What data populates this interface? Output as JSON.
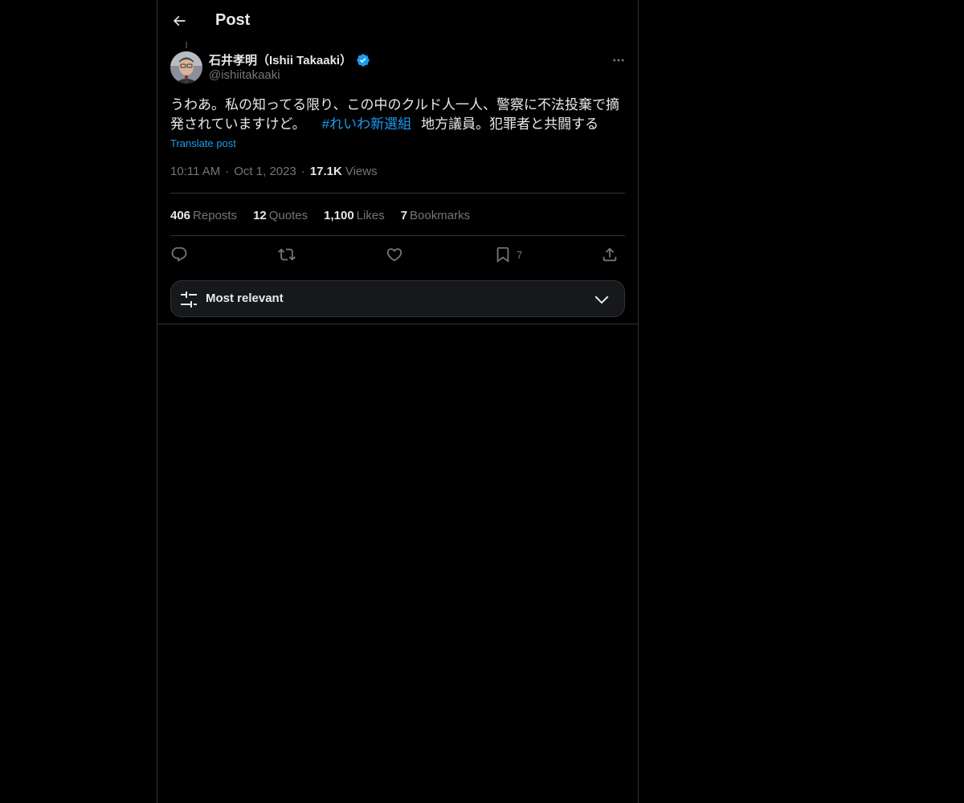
{
  "header": {
    "title": "Post",
    "back_icon": "arrow-left-icon"
  },
  "post": {
    "author_name": "石井孝明（Ishii Takaaki）",
    "handle": "@ishiitakaaki",
    "verified": true,
    "text_part1": "うわあ。私の知ってる限り、この中のクルド人一人、警察に不法投棄で摘発されていますけど。",
    "hashtag": "#れいわ新選組",
    "text_part2": "地方議員。犯罪者と共闘する",
    "translate_label": "Translate post",
    "time": "10:11 AM",
    "date": "Oct 1, 2023",
    "views_count": "17.1K",
    "views_label": "Views"
  },
  "stats": {
    "reposts_count": "406",
    "reposts_label": "Reposts",
    "quotes_count": "12",
    "quotes_label": "Quotes",
    "likes_count": "1,100",
    "likes_label": "Likes",
    "bookmarks_count": "7",
    "bookmarks_label": "Bookmarks"
  },
  "actions": {
    "reply_icon": "reply-icon",
    "repost_icon": "repost-icon",
    "like_icon": "heart-icon",
    "bookmark_icon": "bookmark-icon",
    "bookmark_count": "7",
    "share_icon": "share-icon"
  },
  "sort": {
    "label": "Most relevant",
    "icon": "sliders-icon",
    "chevron": "chevron-down-icon"
  },
  "colors": {
    "background": "#000000",
    "text_primary": "#e7e9ea",
    "text_secondary": "#71767b",
    "accent": "#1d9bf0",
    "border": "#2f3336"
  }
}
